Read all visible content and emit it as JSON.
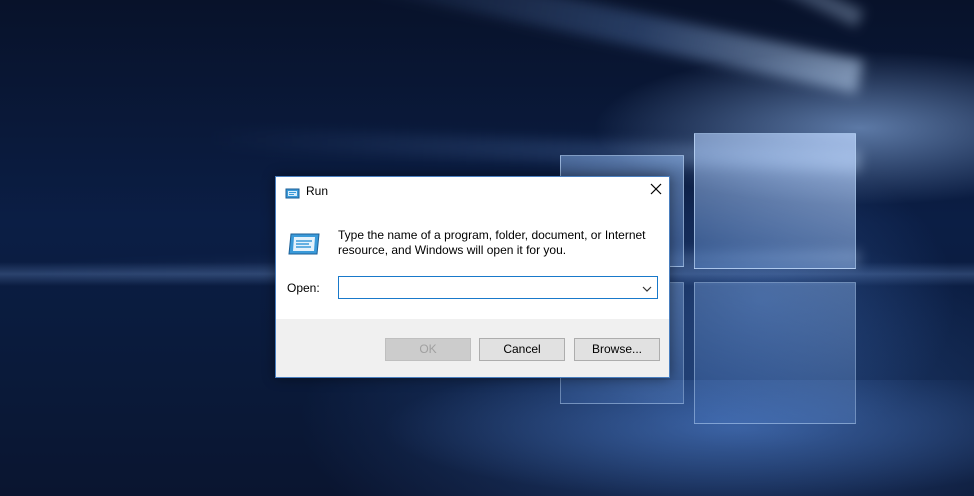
{
  "dialog": {
    "title": "Run",
    "icon": "run-icon",
    "close_icon": "close-icon",
    "description": "Type the name of a program, folder, document, or Internet resource, and Windows will open it for you.",
    "open_label": "Open:",
    "open_value": "",
    "buttons": {
      "ok": "OK",
      "cancel": "Cancel",
      "browse": "Browse..."
    }
  },
  "colors": {
    "accent": "#1979ca",
    "dialog_border": "#4a7fbf",
    "footer_bg": "#f0f0f0",
    "button_bg": "#e1e1e1",
    "disabled_text": "#a0a0a0"
  }
}
